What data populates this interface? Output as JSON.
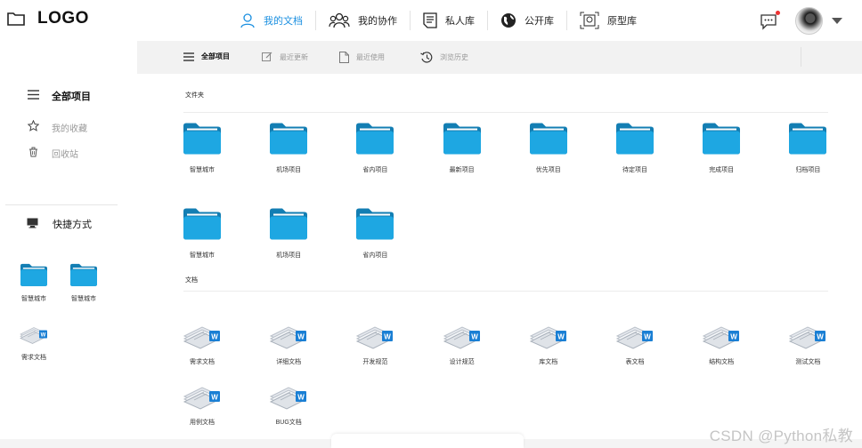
{
  "header": {
    "logo": "LOGO",
    "nav": [
      {
        "label": "我的文档",
        "icon": "user-icon",
        "active": true
      },
      {
        "label": "我的协作",
        "icon": "team-icon",
        "active": false
      },
      {
        "label": "私人库",
        "icon": "document-list-icon",
        "active": false
      },
      {
        "label": "公开库",
        "icon": "globe-icon",
        "active": false
      },
      {
        "label": "原型库",
        "icon": "prototype-icon",
        "active": false
      }
    ],
    "has_notification": true
  },
  "sidebar": {
    "items": [
      {
        "label": "全部项目",
        "icon": "list-icon",
        "active": true
      },
      {
        "label": "我的收藏",
        "icon": "star-icon",
        "active": false
      },
      {
        "label": "回收站",
        "icon": "trash-icon",
        "active": false
      }
    ],
    "shortcuts_title": "快捷方式",
    "shortcuts": [
      {
        "label": "智慧城市",
        "type": "folder"
      },
      {
        "label": "智慧城市",
        "type": "folder"
      },
      {
        "label": "需求文档",
        "type": "document"
      }
    ]
  },
  "toolbar": {
    "items": [
      {
        "label": "全部项目",
        "icon": "menu-icon",
        "active": true
      },
      {
        "label": "最近更新",
        "icon": "edit-icon",
        "active": false
      },
      {
        "label": "最近使用",
        "icon": "file-icon",
        "active": false
      },
      {
        "label": "浏览历史",
        "icon": "history-icon",
        "active": false
      }
    ]
  },
  "main": {
    "folders_title": "文件夹",
    "folders": [
      "智慧城市",
      "机场项目",
      "省内项目",
      "最新项目",
      "优先项目",
      "待定项目",
      "完成项目",
      "归档项目",
      "智慧城市",
      "机场项目",
      "省内项目"
    ],
    "documents_title": "文档",
    "documents": [
      "需求文档",
      "详细文档",
      "开发规范",
      "设计规范",
      "库文档",
      "表文档",
      "结构文档",
      "测试文档",
      "用例文档",
      "BUG文档"
    ]
  },
  "colors": {
    "accent": "#1a8fe0",
    "folder": "#1ea7e2",
    "folder_dark": "#137eb3"
  },
  "watermark": "CSDN @Python私教"
}
